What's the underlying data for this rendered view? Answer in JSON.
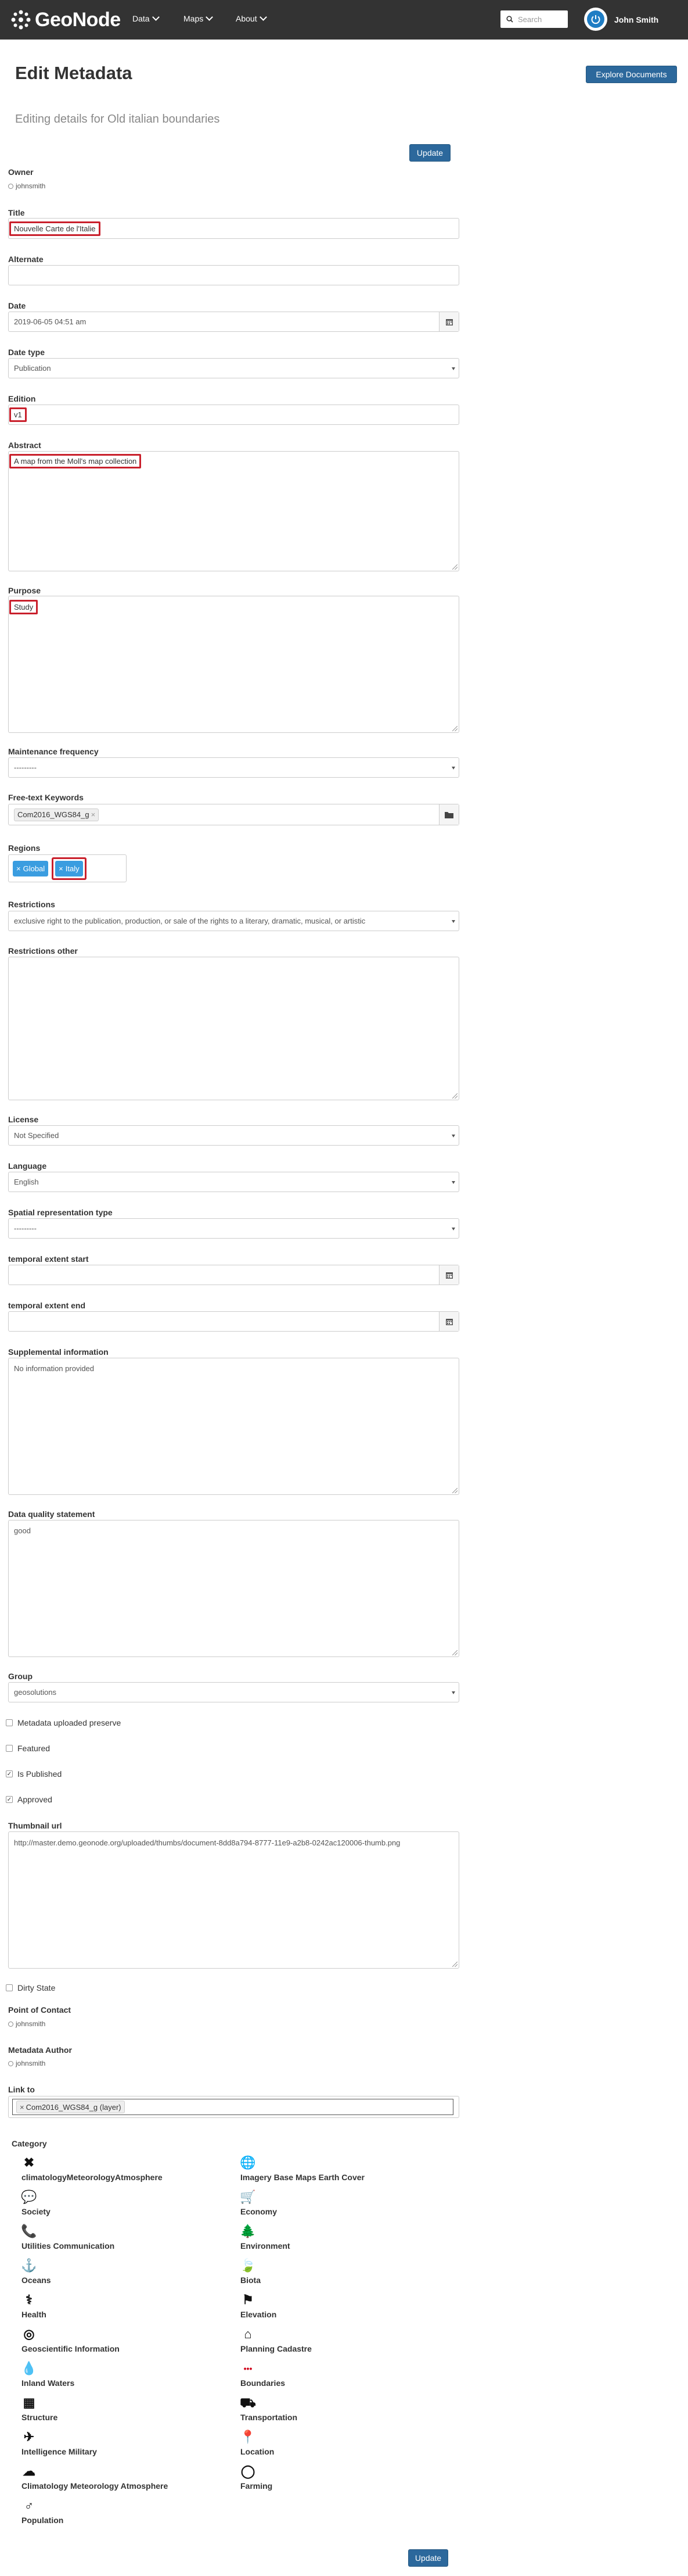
{
  "nav": {
    "brand": "GeoNode",
    "menu": [
      {
        "label": "Data"
      },
      {
        "label": "Maps"
      },
      {
        "label": "About"
      }
    ],
    "search_placeholder": "Search",
    "user": "John Smith"
  },
  "page": {
    "title": "Edit Metadata",
    "explore_button": "Explore Documents",
    "subtitle": "Editing details for Old italian boundaries",
    "update_top": "Update",
    "update_bottom": "Update"
  },
  "owner": {
    "label": "Owner",
    "value": "johnsmith"
  },
  "form": {
    "title": {
      "label": "Title",
      "value": "Nouvelle Carte de l'Italie"
    },
    "alternate": {
      "label": "Alternate",
      "value": ""
    },
    "date": {
      "label": "Date",
      "value": "2019-06-05 04:51 am"
    },
    "date_type": {
      "label": "Date type",
      "value": "Publication"
    },
    "edition": {
      "label": "Edition",
      "value": "v1"
    },
    "abstract": {
      "label": "Abstract",
      "value": "A map from the Moll's map collection"
    },
    "purpose": {
      "label": "Purpose",
      "value": "Study"
    },
    "maintenance": {
      "label": "Maintenance frequency",
      "value": "---------"
    },
    "keywords": {
      "label": "Free-text Keywords",
      "tag": "Com2016_WGS84_g"
    },
    "regions": {
      "label": "Regions",
      "items": [
        "Global",
        "Italy"
      ]
    },
    "restrictions": {
      "label": "Restrictions",
      "value": "exclusive right to the publication, production, or sale of the rights to a literary, dramatic, musical, or artistic"
    },
    "restrictions_other": {
      "label": "Restrictions other",
      "value": ""
    },
    "license": {
      "label": "License",
      "value": "Not Specified"
    },
    "language": {
      "label": "Language",
      "value": "English"
    },
    "spatial": {
      "label": "Spatial representation type",
      "value": "---------"
    },
    "temporal_start": {
      "label": "temporal extent start",
      "value": ""
    },
    "temporal_end": {
      "label": "temporal extent end",
      "value": ""
    },
    "supplemental": {
      "label": "Supplemental information",
      "value": "No information provided"
    },
    "quality": {
      "label": "Data quality statement",
      "value": "good"
    },
    "group": {
      "label": "Group",
      "value": "geosolutions"
    },
    "checks": [
      {
        "label": "Metadata uploaded preserve",
        "checked": false
      },
      {
        "label": "Featured",
        "checked": false
      },
      {
        "label": "Is Published",
        "checked": true
      },
      {
        "label": "Approved",
        "checked": true
      }
    ],
    "thumbnail": {
      "label": "Thumbnail url",
      "value": "http://master.demo.geonode.org/uploaded/thumbs/document-8dd8a794-8777-11e9-a2b8-0242ac120006-thumb.png"
    },
    "dirty": {
      "label": "Dirty State",
      "checked": false
    },
    "poc": {
      "label": "Point of Contact",
      "value": "johnsmith"
    },
    "author": {
      "label": "Metadata Author",
      "value": "johnsmith"
    },
    "link": {
      "label": "Link to",
      "tag": "Com2016_WGS84_g (layer)"
    }
  },
  "category": {
    "label": "Category",
    "left": [
      {
        "name": "climatologyMeteorologyAtmosphere",
        "icon": "close-x-icon"
      },
      {
        "name": "Society",
        "icon": "comments-icon"
      },
      {
        "name": "Utilities Communication",
        "icon": "phone-icon"
      },
      {
        "name": "Oceans",
        "icon": "anchor-icon"
      },
      {
        "name": "Health",
        "icon": "stethoscope-icon"
      },
      {
        "name": "Geoscientific Information",
        "icon": "bullseye-icon"
      },
      {
        "name": "Inland Waters",
        "icon": "tint-icon"
      },
      {
        "name": "Structure",
        "icon": "building-icon"
      },
      {
        "name": "Intelligence Military",
        "icon": "plane-icon"
      },
      {
        "name": "Climatology Meteorology Atmosphere",
        "icon": "cloud-icon"
      },
      {
        "name": "Population",
        "icon": "male-icon"
      }
    ],
    "right": [
      {
        "name": "Imagery Base Maps Earth Cover",
        "icon": "globe-icon"
      },
      {
        "name": "Economy",
        "icon": "cart-icon"
      },
      {
        "name": "Environment",
        "icon": "tree-icon"
      },
      {
        "name": "Biota",
        "icon": "leaf-icon"
      },
      {
        "name": "Elevation",
        "icon": "flag-icon"
      },
      {
        "name": "Planning Cadastre",
        "icon": "home-icon"
      },
      {
        "name": "Boundaries",
        "icon": "ellipsis-icon"
      },
      {
        "name": "Transportation",
        "icon": "truck-icon"
      },
      {
        "name": "Location",
        "icon": "map-marker-icon"
      },
      {
        "name": "Farming",
        "icon": "lemon-icon"
      }
    ]
  }
}
